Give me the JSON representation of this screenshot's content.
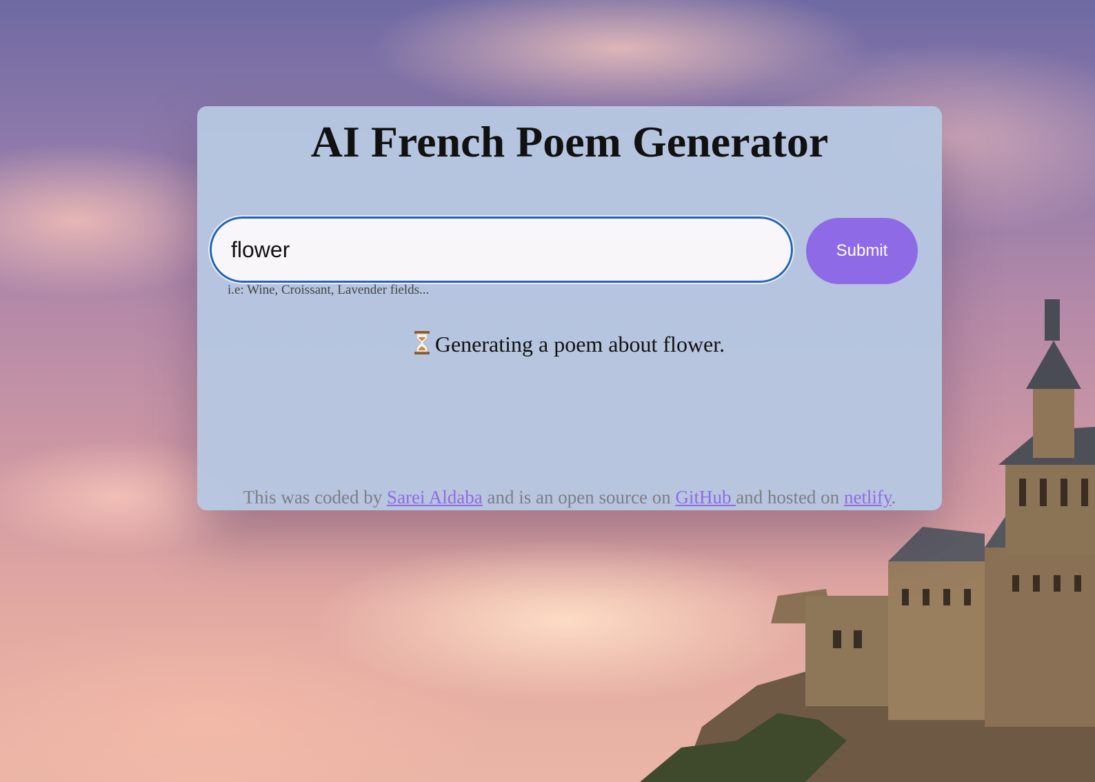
{
  "app": {
    "title": "AI French Poem Generator"
  },
  "search": {
    "value": "flower",
    "submit_label": "Submit",
    "hint": "i.e: Wine, Croissant, Lavender fields..."
  },
  "status": {
    "icon": "hourglass-icon",
    "text": "Generating a poem about flower."
  },
  "footer": {
    "text_1": "This was coded by ",
    "author_link": "Sarei Aldaba",
    "text_2": " and is an open source on ",
    "github_link": "GitHub ",
    "text_3": "and hosted on ",
    "netlify_link": "netlify",
    "text_4": "."
  },
  "colors": {
    "accent": "#8f6ae6",
    "input_border": "#1f64b8",
    "card_background": "#b6c7e1"
  }
}
